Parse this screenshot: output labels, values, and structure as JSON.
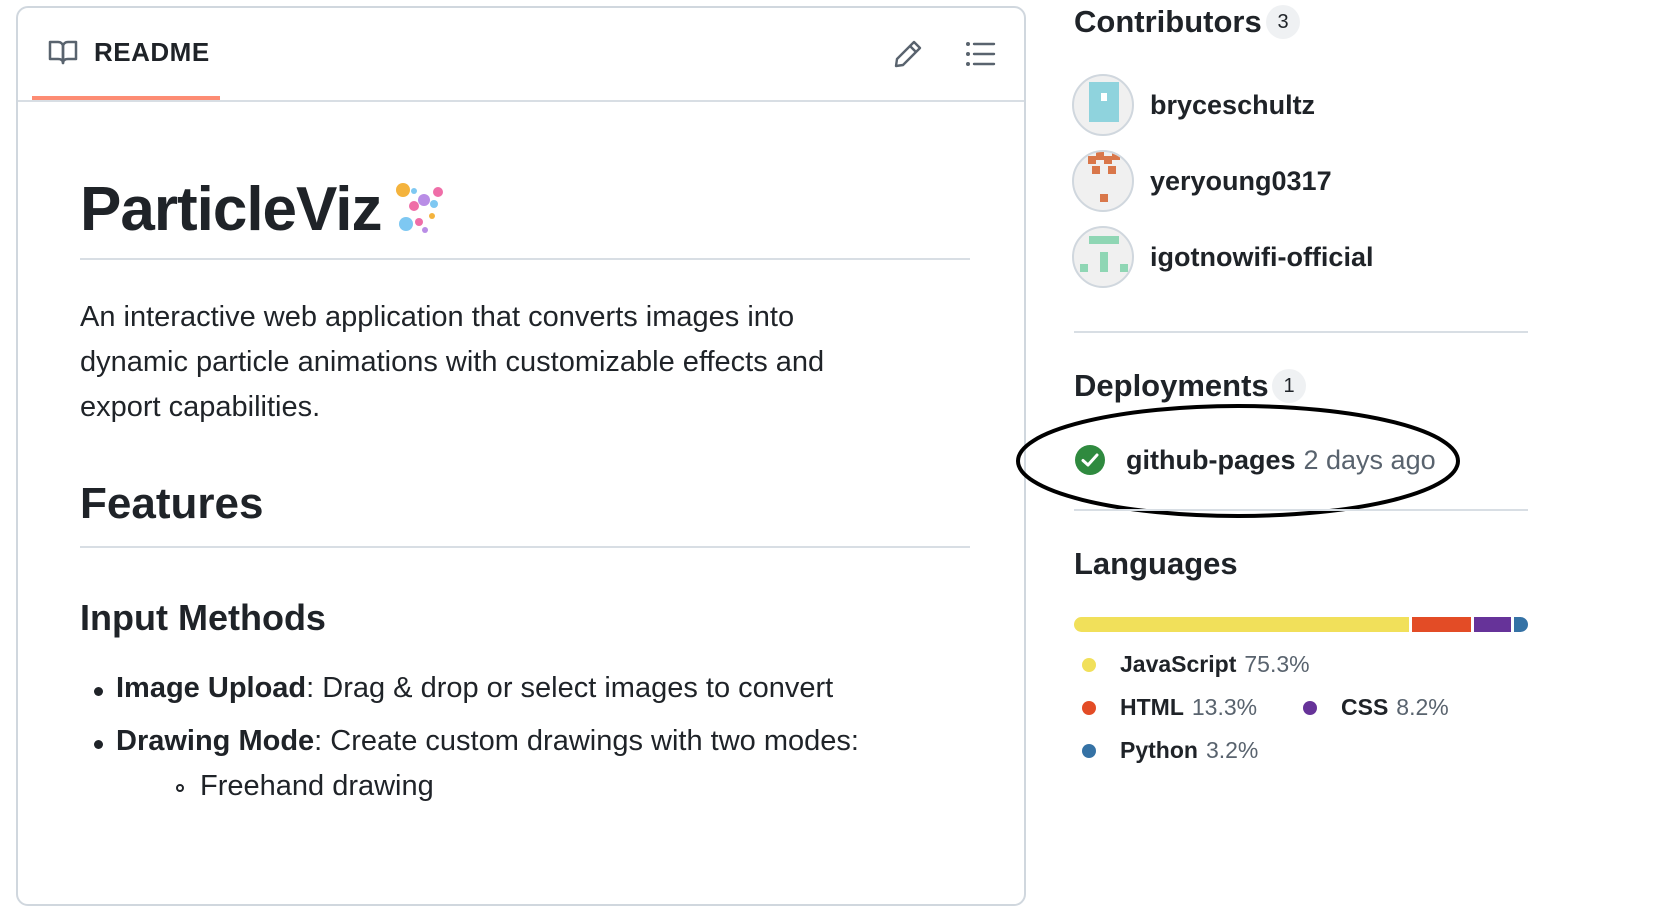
{
  "readme": {
    "tab_label": "README",
    "title": "ParticleViz",
    "description": "An interactive web application that converts images into dynamic particle animations with customizable effects and export capabilities.",
    "desc_lines": [
      "An interactive web application that converts images into",
      "dynamic particle animations with customizable effects and",
      "export capabilities."
    ],
    "features_heading": "Features",
    "input_methods_heading": "Input Methods",
    "list_items": [
      {
        "bold": "Image Upload",
        "rest": ": Drag & drop or select images to convert"
      },
      {
        "bold": "Drawing Mode",
        "rest": ": Create custom drawings with two modes:"
      }
    ],
    "sub_items": [
      "Freehand drawing"
    ]
  },
  "sidebar": {
    "contributors": {
      "title": "Contributors",
      "count": "3",
      "people": [
        {
          "name": "bryceschultz"
        },
        {
          "name": "yeryoung0317"
        },
        {
          "name": "igotnowifi-official"
        }
      ]
    },
    "deployments": {
      "title": "Deployments",
      "count": "1",
      "items": [
        {
          "name": "github-pages",
          "time": "2 days ago"
        }
      ]
    },
    "languages": {
      "title": "Languages",
      "items": [
        {
          "name": "JavaScript",
          "percent": "75.3%",
          "value": 75.3,
          "color": "#f1e05a"
        },
        {
          "name": "HTML",
          "percent": "13.3%",
          "value": 13.3,
          "color": "#e34c26"
        },
        {
          "name": "CSS",
          "percent": "8.2%",
          "value": 8.2,
          "color": "#663399"
        },
        {
          "name": "Python",
          "percent": "3.2%",
          "value": 3.2,
          "color": "#3572A5"
        }
      ]
    }
  },
  "icons": {
    "readme": "book-icon",
    "edit": "pencil-icon",
    "toc": "list-icon",
    "deploy_status": "check-circle-icon",
    "title_emoji": "sparkles-emoji-icon"
  }
}
